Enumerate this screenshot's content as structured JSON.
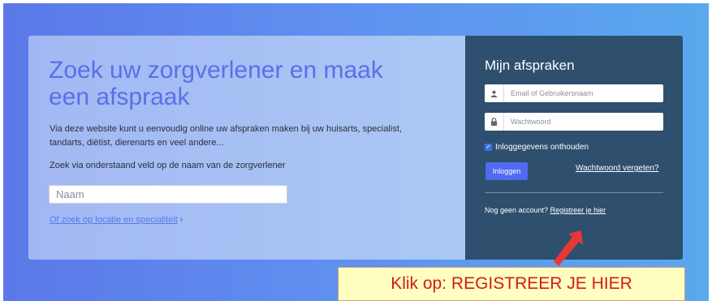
{
  "hero": {
    "title": "Zoek uw zorgverlener en maak een afspraak",
    "intro": "Via deze website kunt u eenvoudig online uw afspraken maken bij uw huisarts, specialist, tandarts, diëtist, dierenarts en veel andere...",
    "search_hint": "Zoek via onderstaand veld op de naam van de zorgverlener",
    "name_placeholder": "Naam",
    "location_link": "Of zoek op locatie en specialiteit"
  },
  "login": {
    "title": "Mijn afspraken",
    "email_placeholder": "Email of Gebruikersnaam",
    "password_placeholder": "Wachtwoord",
    "remember_label": "Inloggegevens onthouden",
    "remember_checked": true,
    "login_button": "Inloggen",
    "forgot_link": "Wachtwoord vergeten?",
    "no_account_text": "Nog geen account?",
    "register_link": "Registreer je hier"
  },
  "annotation": {
    "callout_text": "Klik op: REGISTREER JE HIER",
    "arrow_color": "#e53935"
  },
  "colors": {
    "accent": "#4f6bf0",
    "panel_dark": "#2e4f6e",
    "callout_text": "#d31b1b",
    "callout_bg": "#ffffc2"
  }
}
